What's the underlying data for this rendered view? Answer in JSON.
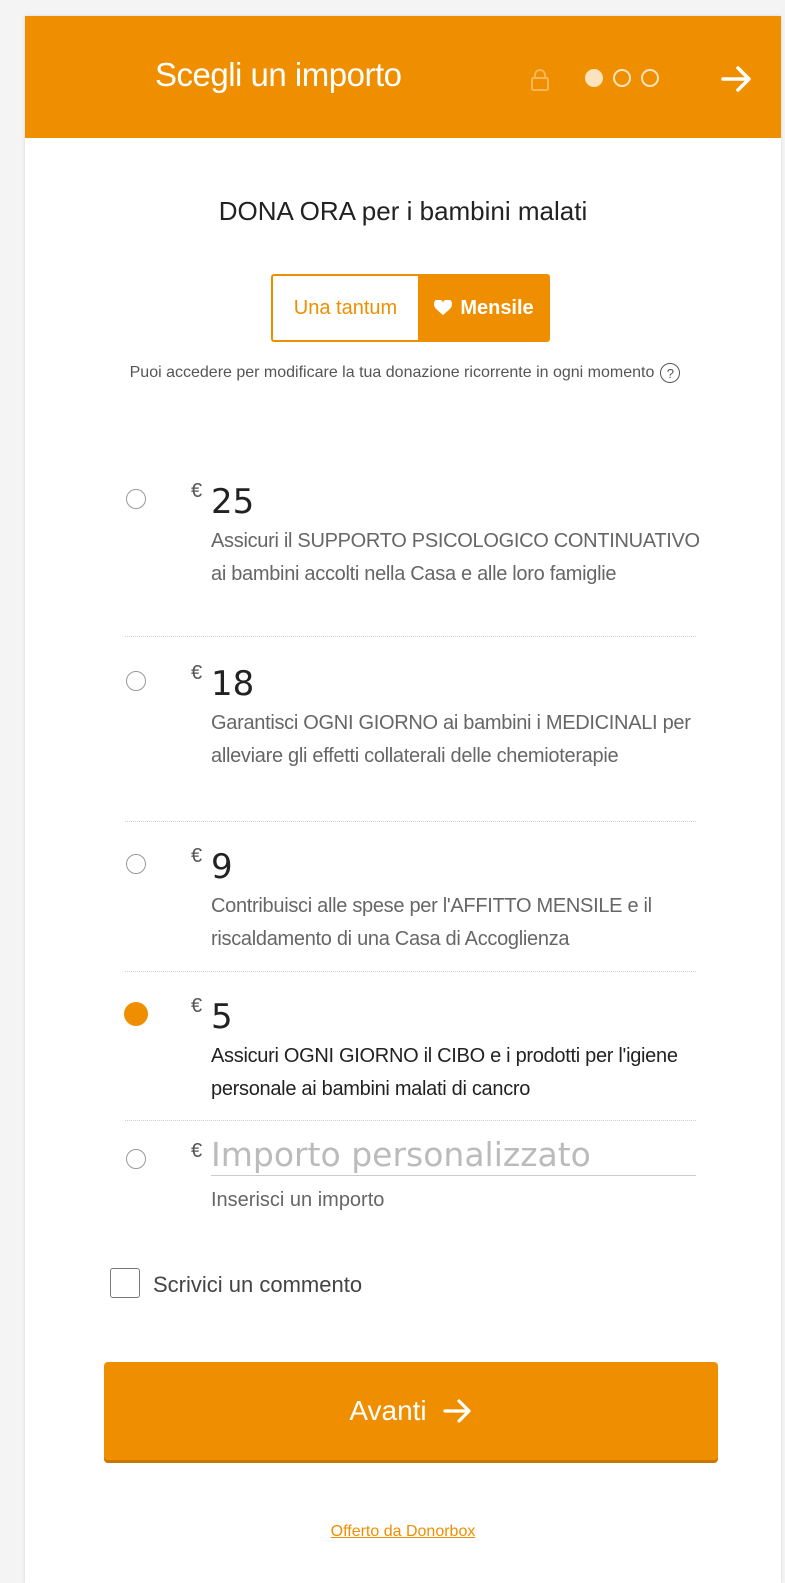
{
  "header": {
    "title": "Scegli un importo",
    "steps": 3,
    "current_step": 1
  },
  "subtitle": "DONA ORA per i bambini malati",
  "frequency": {
    "once_label": "Una tantum",
    "monthly_label": "Mensile",
    "selected": "monthly"
  },
  "note": "Puoi accedere per modificare la tua donazione ricorrente in ogni momento",
  "help_icon": "?",
  "currency_symbol": "€",
  "options": [
    {
      "amount": "25",
      "description": "Assicuri il SUPPORTO PSICOLOGICO CONTINUATIVO ai bambini accolti nella Casa e alle loro famiglie",
      "selected": false
    },
    {
      "amount": "18",
      "description": "Garantisci OGNI GIORNO ai bambini i MEDICINALI per alleviare gli effetti collaterali delle chemioterapie",
      "selected": false
    },
    {
      "amount": "9",
      "description": "Contribuisci alle spese per l'AFFITTO MENSILE e il riscaldamento di una Casa di Accoglienza",
      "selected": false
    },
    {
      "amount": "5",
      "description": "Assicuri OGNI GIORNO il CIBO e i prodotti per l'igiene personale ai bambini malati di cancro",
      "selected": true
    }
  ],
  "custom": {
    "placeholder": "Importo personalizzato",
    "value": "",
    "help": "Inserisci un importo"
  },
  "comment_label": "Scrivici un commento",
  "next_button_label": "Avanti",
  "powered_by": "Offerto da Donorbox",
  "colors": {
    "accent": "#ef8f00"
  }
}
